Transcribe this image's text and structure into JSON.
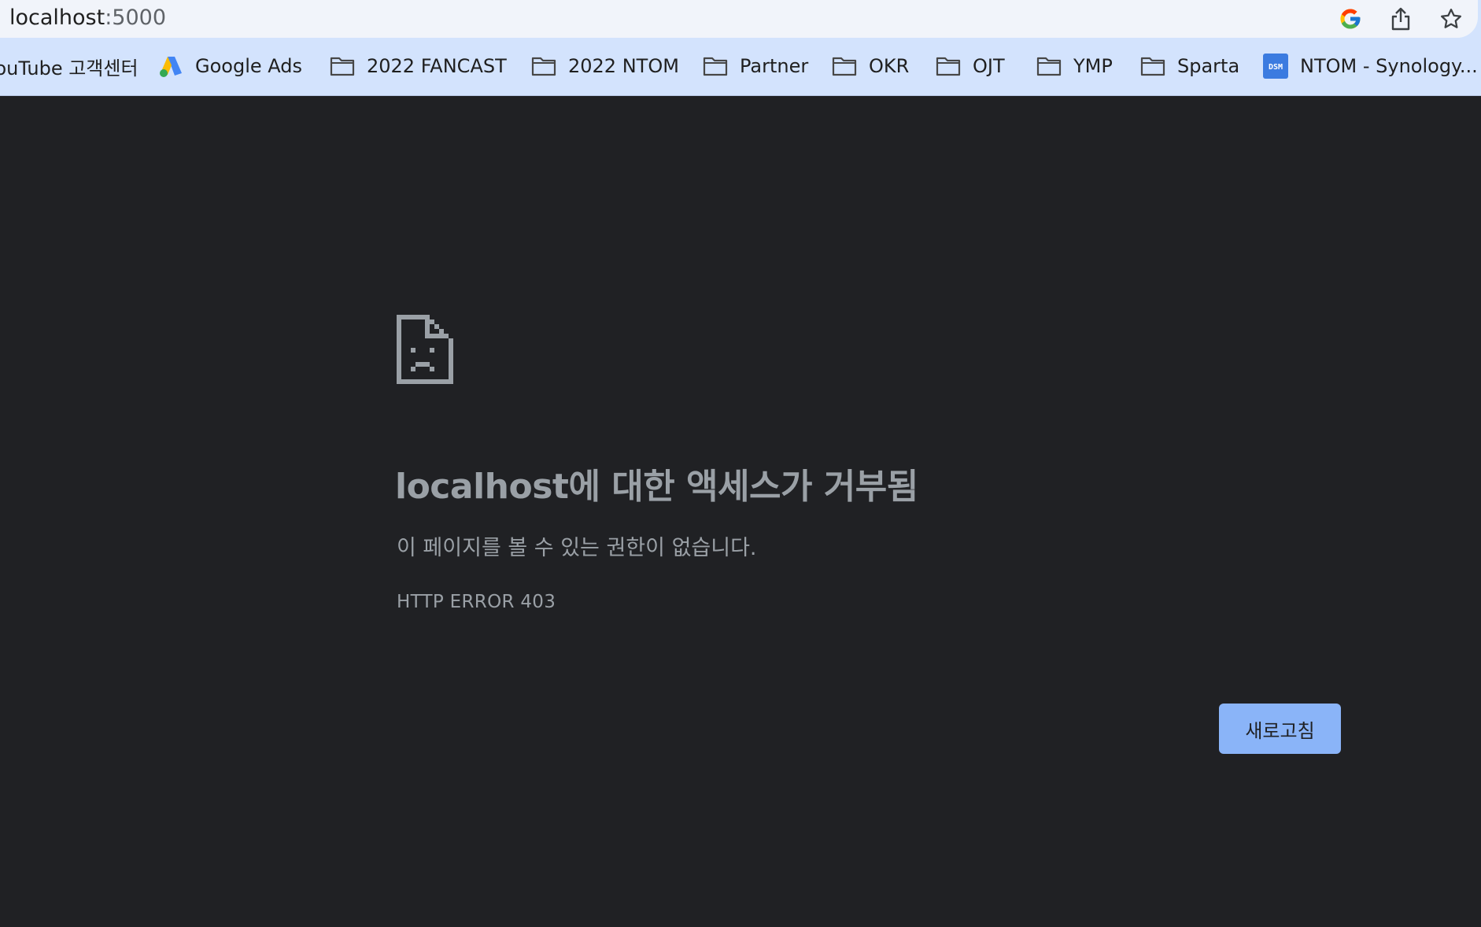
{
  "browser": {
    "url_host": "localhost",
    "url_port": ":5000",
    "icons": [
      "google-icon",
      "share-icon",
      "bookmark-star-icon"
    ]
  },
  "bookmarks": [
    {
      "label": "YouTube 고객센터",
      "icon": "youtube-icon"
    },
    {
      "label": "Google Ads",
      "icon": "google-ads-icon"
    },
    {
      "label": "2022 FANCAST",
      "icon": "folder-icon"
    },
    {
      "label": "2022 NTOM",
      "icon": "folder-icon"
    },
    {
      "label": "Partner",
      "icon": "folder-icon"
    },
    {
      "label": "OKR",
      "icon": "folder-icon"
    },
    {
      "label": "OJT",
      "icon": "folder-icon"
    },
    {
      "label": "YMP",
      "icon": "folder-icon"
    },
    {
      "label": "Sparta",
      "icon": "folder-icon"
    },
    {
      "label": "NTOM - Synology...",
      "icon": "dsm-icon",
      "icon_text": "DSM"
    }
  ],
  "error": {
    "icon": "sad-file-icon",
    "title": "localhost에 대한 액세스가 거부됨",
    "message": "이 페이지를 볼 수 있는 권한이 없습니다.",
    "code": "HTTP ERROR 403",
    "reload_label": "새로고침"
  },
  "colors": {
    "background": "#202124",
    "text": "#9aa0a6",
    "button": "#8ab4f8",
    "bookmark_bar": "#d3e3fd"
  }
}
